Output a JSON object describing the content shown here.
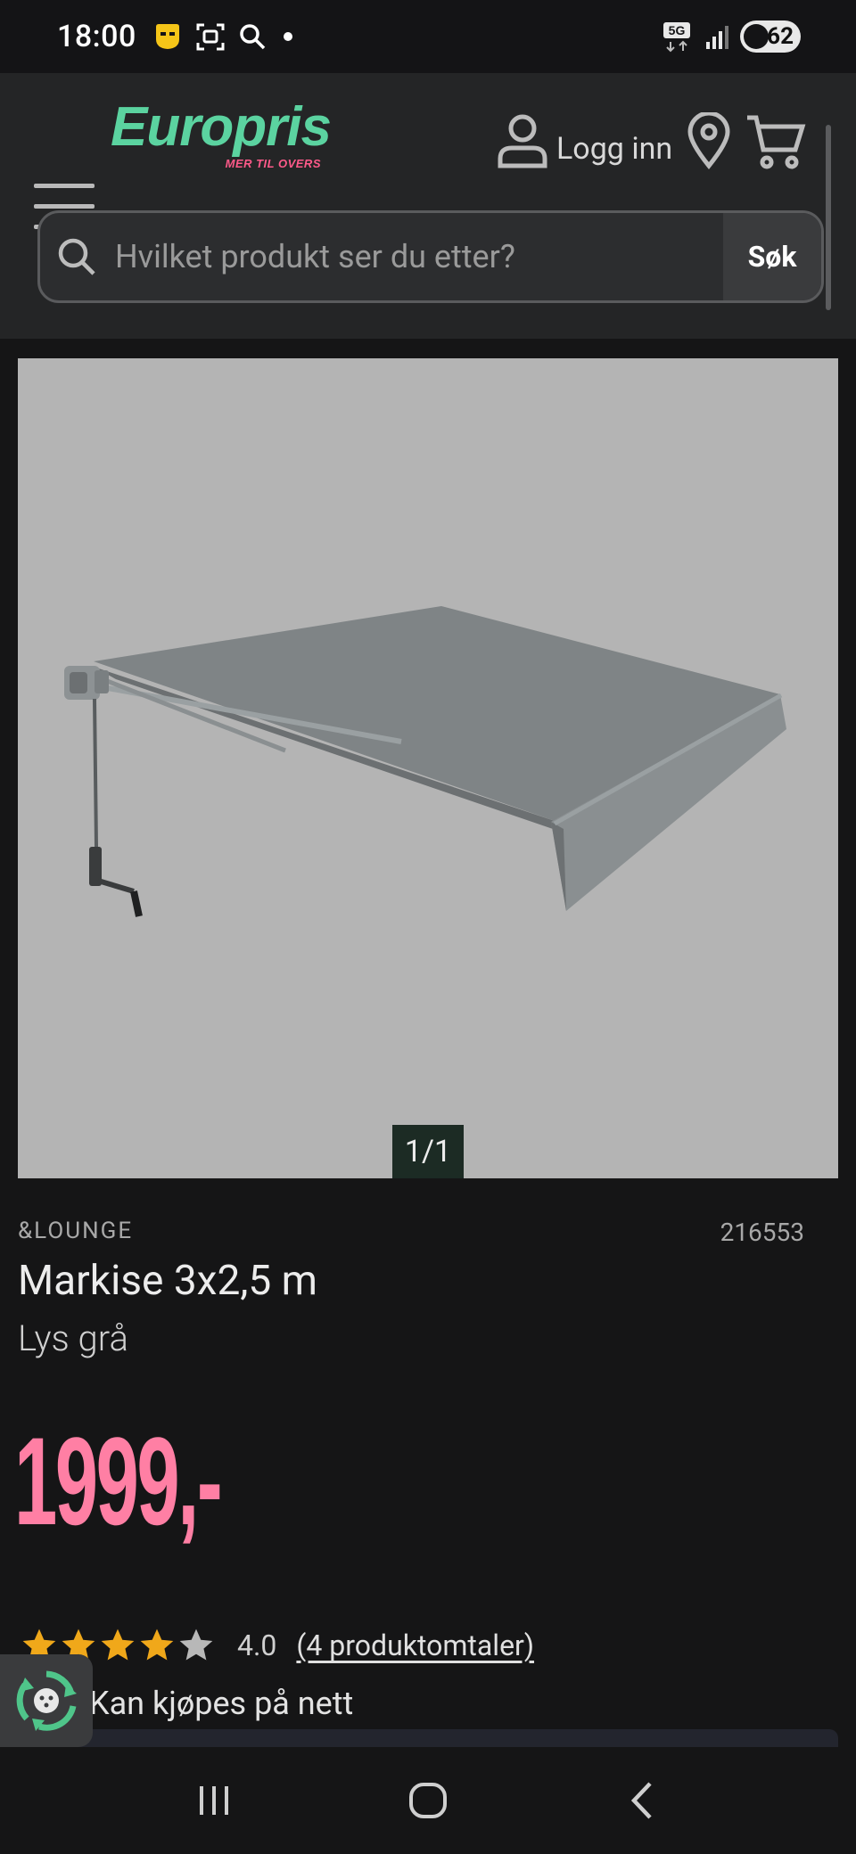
{
  "status_bar": {
    "time": "18:00",
    "network": "5G",
    "battery": "62",
    "icons": [
      "chat-app-icon",
      "screenshot-icon",
      "search-icon",
      "dot-icon",
      "signal-icon"
    ]
  },
  "header": {
    "logo_text": "Europris",
    "logo_tagline": "MER TIL OVERS",
    "login_label": "Logg inn",
    "search_placeholder": "Hvilket produkt ser du etter?",
    "search_button": "Søk",
    "colors": {
      "brand_green": "#5bd3a0",
      "brand_pink": "#ff5a8a"
    }
  },
  "product": {
    "image_counter": "1/1",
    "brand": "&LOUNGE",
    "sku": "216553",
    "title": "Markise 3x2,5 m",
    "variant": "Lys grå",
    "price": "1999,-",
    "price_color": "#ff7fa4",
    "rating": {
      "stars_filled": 4,
      "stars_total": 5,
      "value": "4.0",
      "reviews_label": "(4 produktomtaler)"
    },
    "availability": "Kan kjøpes på nett"
  },
  "nav_bar": {
    "buttons": [
      "recent-apps",
      "home",
      "back"
    ]
  }
}
